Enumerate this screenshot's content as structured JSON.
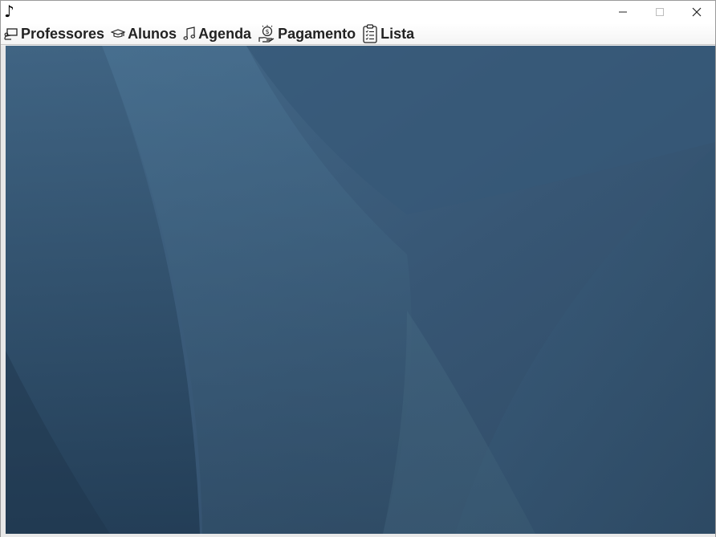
{
  "window": {
    "app_icon": "music-note-icon",
    "app_icon_glyph": "♪",
    "controls": [
      "minimize",
      "maximize",
      "close"
    ]
  },
  "menubar": {
    "items": [
      {
        "label": "Professores",
        "icon": "teacher-board-icon"
      },
      {
        "label": "Alunos",
        "icon": "graduation-cap-icon"
      },
      {
        "label": "Agenda",
        "icon": "music-notes-icon"
      },
      {
        "label": "Pagamento",
        "icon": "money-hand-icon"
      },
      {
        "label": "Lista",
        "icon": "clipboard-list-icon"
      }
    ]
  },
  "colors": {
    "desktop_base": "#3a5a78",
    "desktop_light": "#4a7190",
    "desktop_dark": "#233d55"
  }
}
